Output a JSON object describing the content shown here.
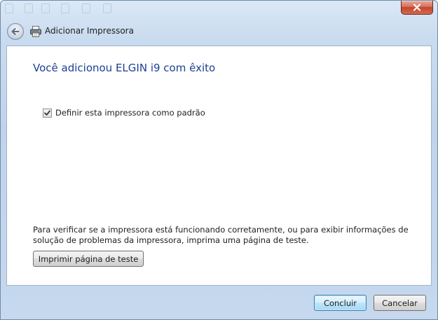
{
  "window": {
    "title": "Adicionar Impressora"
  },
  "main": {
    "heading": "Você adicionou ELGIN i9 com êxito",
    "default_printer_checkbox": {
      "label": "Definir esta impressora como padrão",
      "checked": true
    },
    "info_text": "Para verificar se a impressora está funcionando corretamente, ou para exibir informações de solução de problemas da impressora, imprima uma página de teste.",
    "print_test_label": "Imprimir página de teste"
  },
  "footer": {
    "finish_label": "Concluir",
    "cancel_label": "Cancelar"
  },
  "icons": {
    "close": "close-icon",
    "back": "back-arrow-icon",
    "printer": "printer-icon",
    "checkbox": "checkmark-icon"
  },
  "colors": {
    "heading": "#1c3f95",
    "close_button": "#c4452c",
    "default_button_border": "#3c7fb1"
  }
}
